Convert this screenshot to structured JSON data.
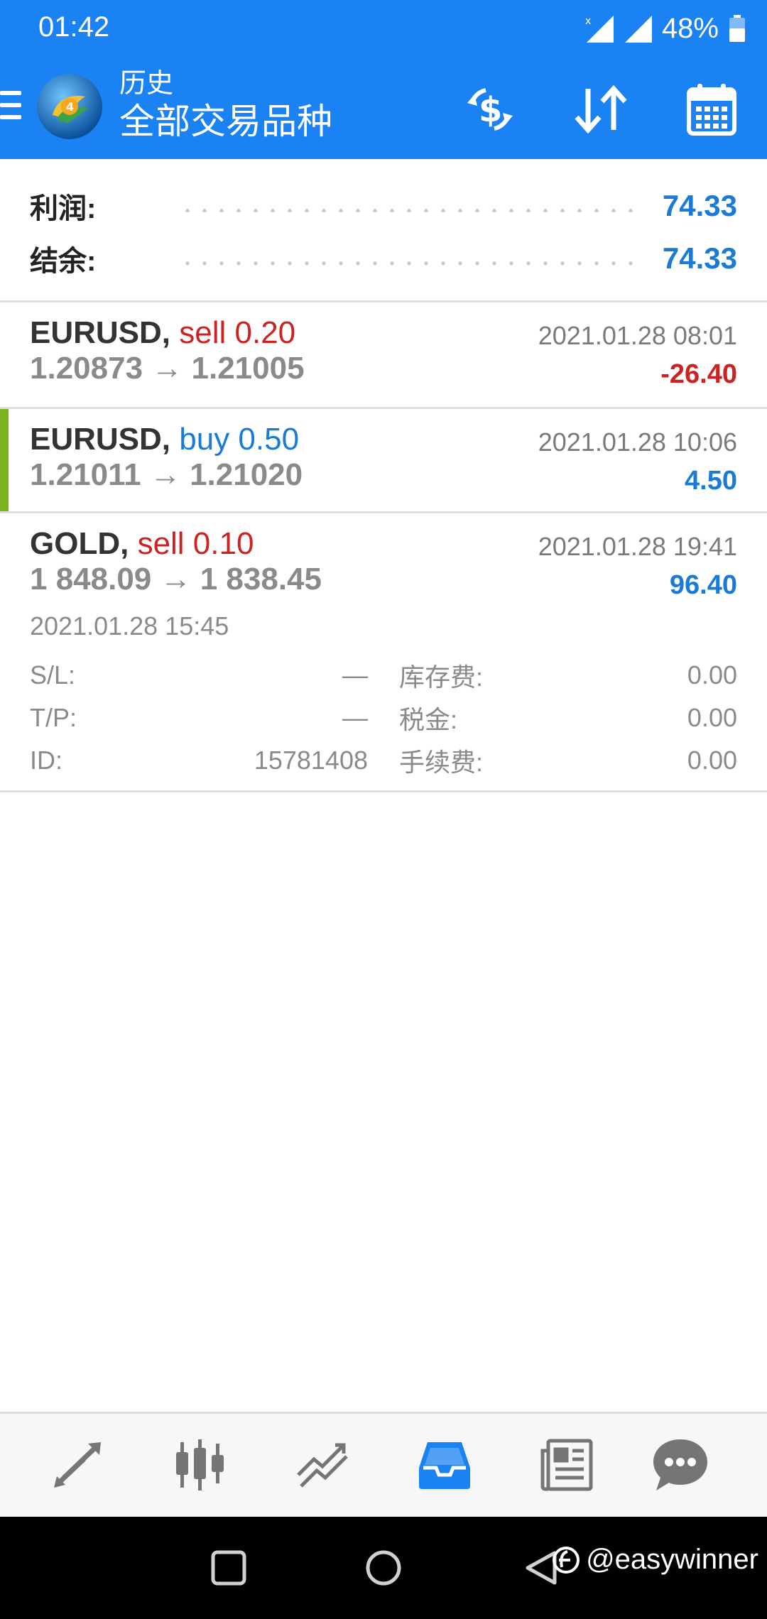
{
  "status_bar": {
    "time": "01:42",
    "battery_percent": "48%"
  },
  "toolbar": {
    "title_small": "历史",
    "title_large": "全部交易品种"
  },
  "summary": [
    {
      "label": "利润:",
      "value": "74.33"
    },
    {
      "label": "结余:",
      "value": "74.33"
    }
  ],
  "trades": [
    {
      "symbol": "EURUSD,",
      "side_volume": "sell 0.20",
      "side": "sell",
      "prices": "1.20873 → 1.21005",
      "time": "2021.01.28 08:01",
      "profit": "-26.40"
    },
    {
      "symbol": "EURUSD,",
      "side_volume": "buy 0.50",
      "side": "buy",
      "prices": "1.21011 → 1.21020",
      "time": "2021.01.28 10:06",
      "profit": "4.50"
    },
    {
      "symbol": "GOLD,",
      "side_volume": "sell 0.10",
      "side": "sell",
      "prices": "1 848.09 → 1 838.45",
      "time": "2021.01.28 19:41",
      "profit": "96.40",
      "details": {
        "open_time": "2021.01.28 15:45",
        "sl_label": "S/L:",
        "sl_value": "—",
        "tp_label": "T/P:",
        "tp_value": "—",
        "id_label": "ID:",
        "id_value": "15781408",
        "swap_label": "库存费:",
        "swap_value": "0.00",
        "tax_label": "税金:",
        "tax_value": "0.00",
        "commission_label": "手续费:",
        "commission_value": "0.00"
      }
    }
  ],
  "bottom_nav": {
    "items": [
      "quotes-icon",
      "chart-icon",
      "trade-icon",
      "history-icon",
      "news-icon",
      "chat-icon"
    ],
    "active_color": "#1a82f2",
    "inactive_color": "#757575"
  },
  "watermark": {
    "text": "@easywinner"
  },
  "colors": {
    "header": "#1a82f2",
    "sell": "#cc2222",
    "buy": "#1a7bd6",
    "selected_bar": "#7ab51d"
  }
}
